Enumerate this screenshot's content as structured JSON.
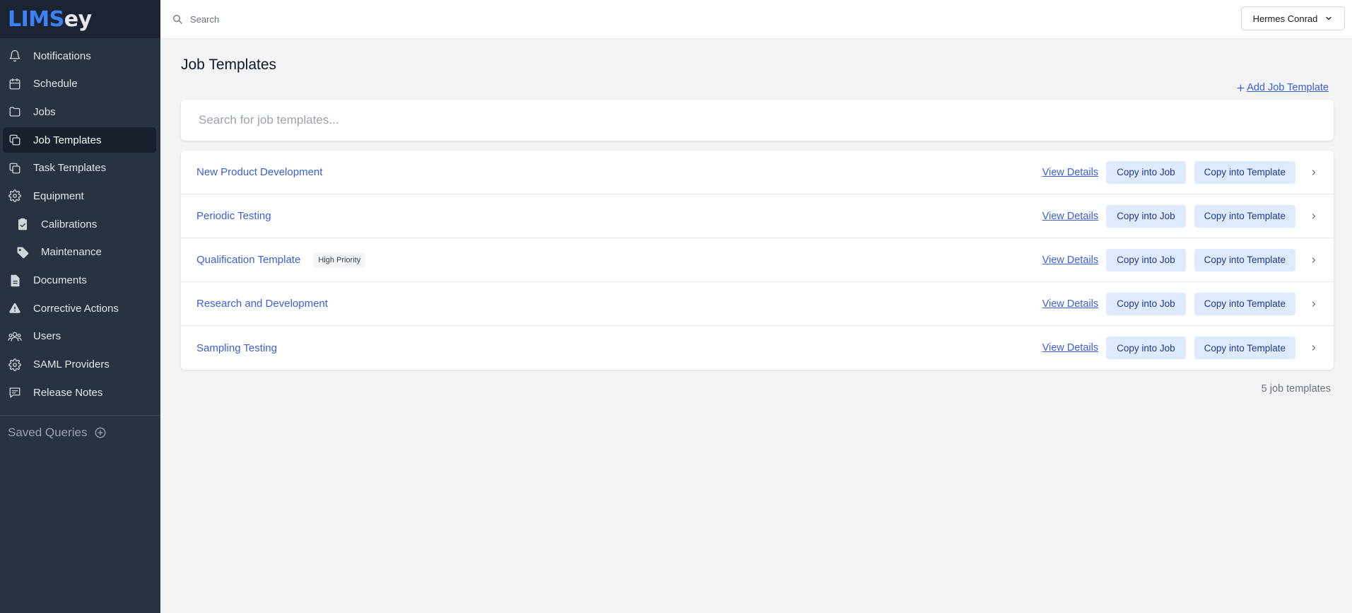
{
  "app": {
    "logo_part1": "LIMS",
    "logo_part2": "ey"
  },
  "sidebar": {
    "items": [
      {
        "label": "Notifications",
        "icon": "bell-icon"
      },
      {
        "label": "Schedule",
        "icon": "calendar-icon"
      },
      {
        "label": "Jobs",
        "icon": "folder-icon"
      },
      {
        "label": "Job Templates",
        "icon": "copy-icon",
        "active": true
      },
      {
        "label": "Task Templates",
        "icon": "copy-icon"
      },
      {
        "label": "Equipment",
        "icon": "gear-icon"
      },
      {
        "label": "Calibrations",
        "icon": "clipboard-check-icon"
      },
      {
        "label": "Maintenance",
        "icon": "tag-icon"
      },
      {
        "label": "Documents",
        "icon": "document-icon"
      },
      {
        "label": "Corrective Actions",
        "icon": "warning-icon"
      },
      {
        "label": "Users",
        "icon": "users-icon"
      },
      {
        "label": "SAML Providers",
        "icon": "gear-icon"
      },
      {
        "label": "Release Notes",
        "icon": "chat-icon"
      }
    ],
    "saved_queries_label": "Saved Queries"
  },
  "topbar": {
    "search_placeholder": "Search",
    "user_name": "Hermes Conrad"
  },
  "main": {
    "title": "Job Templates",
    "add_label": "Add Job Template",
    "search_placeholder": "Search for job templates...",
    "view_details_label": "View Details",
    "copy_job_label": "Copy into Job",
    "copy_template_label": "Copy into Template",
    "templates": [
      {
        "name": "New Product Development",
        "badge": ""
      },
      {
        "name": "Periodic Testing",
        "badge": ""
      },
      {
        "name": "Qualification Template",
        "badge": "High Priority"
      },
      {
        "name": "Research and Development",
        "badge": ""
      },
      {
        "name": "Sampling Testing",
        "badge": ""
      }
    ],
    "count_text": "5 job templates"
  },
  "colors": {
    "sidebar_bg": "#283241",
    "link": "#3b5fd6",
    "button_bg": "#e0eaff",
    "brand": "#3b82f6"
  }
}
